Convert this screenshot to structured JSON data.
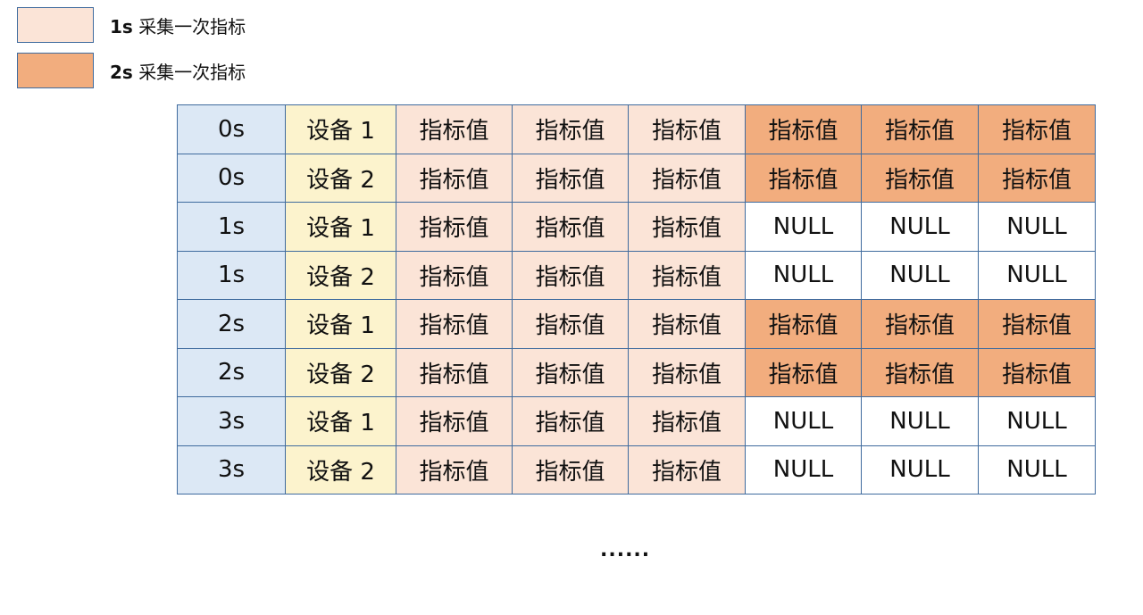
{
  "colors": {
    "time": "#dce8f5",
    "device": "#fcf3cd",
    "light": "#fbe4d7",
    "dark": "#f2ad7e",
    "null": "#ffffff",
    "border": "#3f6b9e"
  },
  "legend": [
    {
      "interval": "1s",
      "text": "采集一次指标",
      "color": "light"
    },
    {
      "interval": "2s",
      "text": "采集一次指标",
      "color": "dark"
    }
  ],
  "rows": [
    {
      "time": "0s",
      "device": "设备 1",
      "cells": [
        {
          "v": "指标值",
          "c": "light"
        },
        {
          "v": "指标值",
          "c": "light"
        },
        {
          "v": "指标值",
          "c": "light"
        },
        {
          "v": "指标值",
          "c": "dark"
        },
        {
          "v": "指标值",
          "c": "dark"
        },
        {
          "v": "指标值",
          "c": "dark"
        }
      ]
    },
    {
      "time": "0s",
      "device": "设备 2",
      "cells": [
        {
          "v": "指标值",
          "c": "light"
        },
        {
          "v": "指标值",
          "c": "light"
        },
        {
          "v": "指标值",
          "c": "light"
        },
        {
          "v": "指标值",
          "c": "dark"
        },
        {
          "v": "指标值",
          "c": "dark"
        },
        {
          "v": "指标值",
          "c": "dark"
        }
      ]
    },
    {
      "time": "1s",
      "device": "设备 1",
      "cells": [
        {
          "v": "指标值",
          "c": "light"
        },
        {
          "v": "指标值",
          "c": "light"
        },
        {
          "v": "指标值",
          "c": "light"
        },
        {
          "v": "NULL",
          "c": "null"
        },
        {
          "v": "NULL",
          "c": "null"
        },
        {
          "v": "NULL",
          "c": "null"
        }
      ]
    },
    {
      "time": "1s",
      "device": "设备 2",
      "cells": [
        {
          "v": "指标值",
          "c": "light"
        },
        {
          "v": "指标值",
          "c": "light"
        },
        {
          "v": "指标值",
          "c": "light"
        },
        {
          "v": "NULL",
          "c": "null"
        },
        {
          "v": "NULL",
          "c": "null"
        },
        {
          "v": "NULL",
          "c": "null"
        }
      ]
    },
    {
      "time": "2s",
      "device": "设备 1",
      "cells": [
        {
          "v": "指标值",
          "c": "light"
        },
        {
          "v": "指标值",
          "c": "light"
        },
        {
          "v": "指标值",
          "c": "light"
        },
        {
          "v": "指标值",
          "c": "dark"
        },
        {
          "v": "指标值",
          "c": "dark"
        },
        {
          "v": "指标值",
          "c": "dark"
        }
      ]
    },
    {
      "time": "2s",
      "device": "设备 2",
      "cells": [
        {
          "v": "指标值",
          "c": "light"
        },
        {
          "v": "指标值",
          "c": "light"
        },
        {
          "v": "指标值",
          "c": "light"
        },
        {
          "v": "指标值",
          "c": "dark"
        },
        {
          "v": "指标值",
          "c": "dark"
        },
        {
          "v": "指标值",
          "c": "dark"
        }
      ]
    },
    {
      "time": "3s",
      "device": "设备 1",
      "cells": [
        {
          "v": "指标值",
          "c": "light"
        },
        {
          "v": "指标值",
          "c": "light"
        },
        {
          "v": "指标值",
          "c": "light"
        },
        {
          "v": "NULL",
          "c": "null"
        },
        {
          "v": "NULL",
          "c": "null"
        },
        {
          "v": "NULL",
          "c": "null"
        }
      ]
    },
    {
      "time": "3s",
      "device": "设备 2",
      "cells": [
        {
          "v": "指标值",
          "c": "light"
        },
        {
          "v": "指标值",
          "c": "light"
        },
        {
          "v": "指标值",
          "c": "light"
        },
        {
          "v": "NULL",
          "c": "null"
        },
        {
          "v": "NULL",
          "c": "null"
        },
        {
          "v": "NULL",
          "c": "null"
        }
      ]
    }
  ],
  "ellipsis": "......"
}
